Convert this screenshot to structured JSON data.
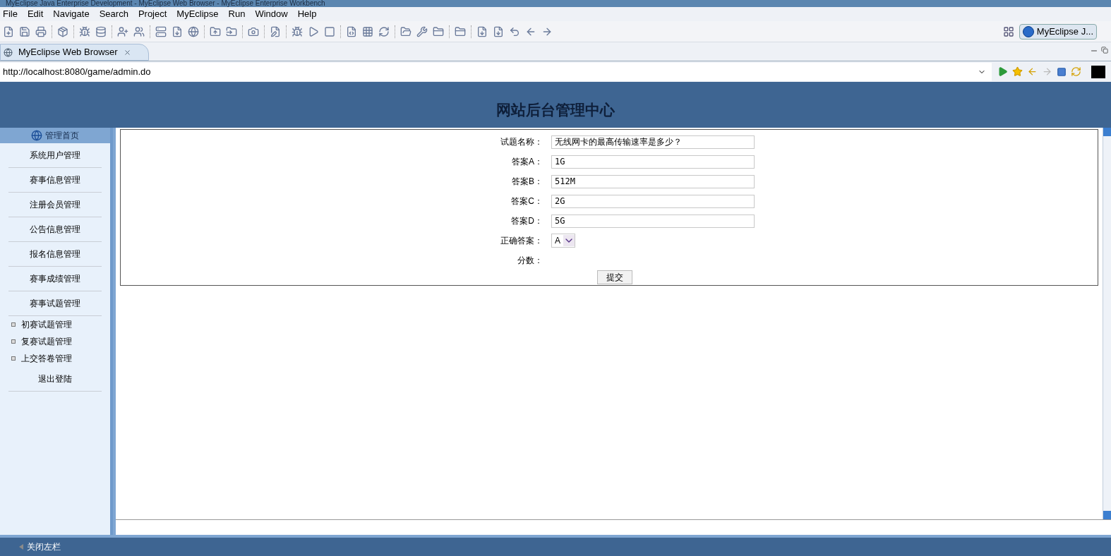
{
  "window": {
    "title": "MyEclipse Java Enterprise Development - MyEclipse Web Browser - MyEclipse Enterprise Workbench"
  },
  "menu": [
    "File",
    "Edit",
    "Navigate",
    "Search",
    "Project",
    "MyEclipse",
    "Run",
    "Window",
    "Help"
  ],
  "perspective": {
    "label": "MyEclipse J..."
  },
  "editor_tab": {
    "label": "MyEclipse Web Browser",
    "selected": true
  },
  "address": {
    "value": "http://localhost:8080/game/admin.do"
  },
  "page": {
    "header": "网站后台管理中心",
    "sidebar": {
      "home": "管理首页",
      "items": [
        {
          "label": "系统用户管理",
          "kind": "main"
        },
        {
          "label": "赛事信息管理",
          "kind": "main"
        },
        {
          "label": "注册会员管理",
          "kind": "main"
        },
        {
          "label": "公告信息管理",
          "kind": "main"
        },
        {
          "label": "报名信息管理",
          "kind": "main"
        },
        {
          "label": "赛事成绩管理",
          "kind": "main"
        },
        {
          "label": "赛事试题管理",
          "kind": "main"
        },
        {
          "label": "初赛试题管理",
          "kind": "sub"
        },
        {
          "label": "复赛试题管理",
          "kind": "sub"
        },
        {
          "label": "上交答卷管理",
          "kind": "sub"
        },
        {
          "label": "退出登陆",
          "kind": "main"
        }
      ]
    },
    "form": {
      "fields": [
        {
          "label": "试题名称：",
          "value": "无线网卡的最高传输速率是多少？",
          "kind": "text"
        },
        {
          "label": "答案A：",
          "value": "1G",
          "kind": "text"
        },
        {
          "label": "答案B：",
          "value": "512M",
          "kind": "text"
        },
        {
          "label": "答案C：",
          "value": "2G",
          "kind": "text"
        },
        {
          "label": "答案D：",
          "value": "5G",
          "kind": "text"
        },
        {
          "label": "正确答案：",
          "value": "A",
          "kind": "select"
        },
        {
          "label": "分数：",
          "kind": "label"
        }
      ],
      "submit": "提交"
    },
    "footer": "关闭左栏"
  }
}
